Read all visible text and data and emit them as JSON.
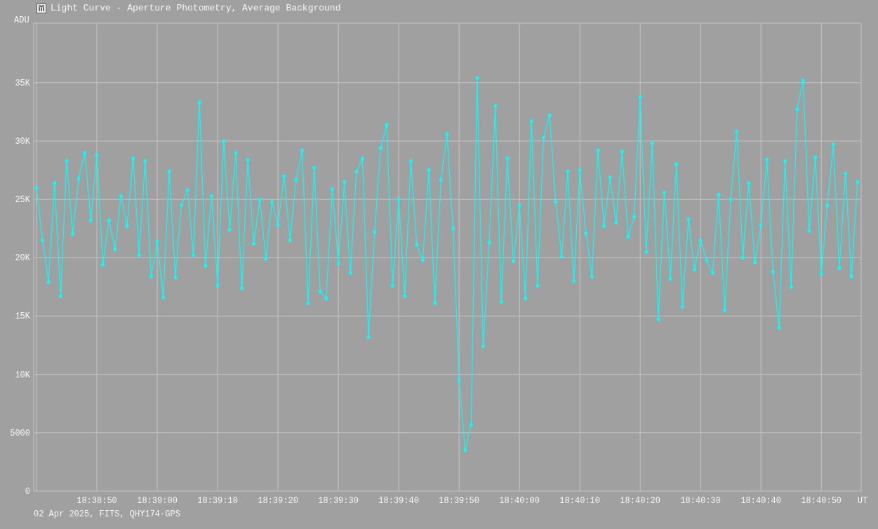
{
  "window": {
    "title": "Light Curve - Aperture Photometry, Average Background"
  },
  "chart": {
    "chart_data": {
      "type": "line",
      "xlabel": "UT",
      "ylabel": "ADU",
      "categories": [
        null,
        null,
        null,
        null,
        null,
        null,
        null,
        null,
        null,
        null,
        "18:38:50",
        null,
        null,
        null,
        null,
        null,
        null,
        null,
        null,
        null,
        "18:39:00",
        null,
        null,
        null,
        null,
        null,
        null,
        null,
        null,
        null,
        "18:39:10",
        null,
        null,
        null,
        null,
        null,
        null,
        null,
        null,
        null,
        "18:39:20",
        null,
        null,
        null,
        null,
        null,
        null,
        null,
        null,
        null,
        "18:39:30",
        null,
        null,
        null,
        null,
        null,
        null,
        null,
        null,
        null,
        "18:39:40",
        null,
        null,
        null,
        null,
        null,
        null,
        null,
        null,
        null,
        "18:39:50",
        null,
        null,
        null,
        null,
        null,
        null,
        null,
        null,
        null,
        "18:40:00",
        null,
        null,
        null,
        null,
        null,
        null,
        null,
        null,
        null,
        "18:40:10",
        null,
        null,
        null,
        null,
        null,
        null,
        null,
        null,
        null,
        "18:40:20",
        null,
        null,
        null,
        null,
        null,
        null,
        null,
        null,
        null,
        "18:40:30",
        null,
        null,
        null,
        null,
        null,
        null,
        null,
        null,
        null,
        "18:40:40",
        null,
        null,
        null,
        null,
        null,
        null,
        null,
        null,
        null,
        "18:40:50",
        null,
        null,
        null,
        null,
        null,
        null
      ],
      "series": [
        {
          "color": "#00ffff",
          "values": [
            26000,
            21500,
            17900,
            26400,
            16700,
            28300,
            22000,
            26800,
            29000,
            23200,
            28800,
            19400,
            23200,
            20700,
            25300,
            22700,
            28500,
            20200,
            28300,
            18400,
            21400,
            16600,
            27400,
            18300,
            24500,
            25800,
            20200,
            33300,
            19300,
            25300,
            17600,
            30000,
            22400,
            29000,
            17400,
            28400,
            21200,
            25000,
            19900,
            24800,
            22800,
            27000,
            21500,
            26700,
            29200,
            16100,
            27700,
            17100,
            16500,
            25900,
            19500,
            26500,
            18700,
            27400,
            28500,
            13200,
            22200,
            29400,
            31400,
            17600,
            25000,
            16700,
            28300,
            21100,
            19800,
            27500,
            16100,
            26700,
            30600,
            22500,
            9500,
            3500,
            5700,
            35400,
            12400,
            21300,
            33000,
            16200,
            28500,
            19700,
            24500,
            16500,
            31700,
            17600,
            30300,
            32200,
            24800,
            20100,
            27400,
            18000,
            27500,
            22100,
            18400,
            29200,
            22700,
            26900,
            23000,
            29100,
            21800,
            23500,
            33800,
            20500,
            29800,
            14700,
            25600,
            18200,
            28000,
            15800,
            23300,
            19000,
            21500,
            19800,
            18700,
            25400,
            15500,
            25000,
            30800,
            20000,
            26400,
            19600,
            22800,
            28400,
            18800,
            14000,
            28300,
            17500,
            32700,
            35200,
            22300,
            28600,
            18600,
            24500,
            29700,
            19100,
            27200,
            18400,
            26500
          ]
        }
      ],
      "ylim": [
        0,
        40100
      ],
      "grid": true,
      "yticks": [
        {
          "value": 0,
          "label": "0"
        },
        {
          "value": 5000,
          "label": "5000"
        },
        {
          "value": 10000,
          "label": "10K"
        },
        {
          "value": 15000,
          "label": "15K"
        },
        {
          "value": 20000,
          "label": "20K"
        },
        {
          "value": 25000,
          "label": "25K"
        },
        {
          "value": 30000,
          "label": "30K"
        },
        {
          "value": 35000,
          "label": "35K"
        }
      ]
    }
  },
  "status_bar": {
    "text": "02 Apr 2025, FITS, QHY174-GPS"
  }
}
